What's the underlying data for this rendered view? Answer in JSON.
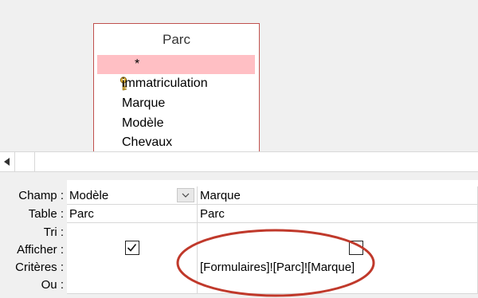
{
  "table": {
    "title": "Parc",
    "fields": [
      "*",
      "immatriculation",
      "Marque",
      "Modèle",
      "Chevaux"
    ]
  },
  "grid": {
    "row_labels": [
      "Champ :",
      "Table :",
      "Tri :",
      "Afficher :",
      "Critères :",
      "Ou :"
    ],
    "columns": [
      {
        "champ": "Modèle",
        "table": "Parc",
        "tri": "",
        "afficher": true,
        "criteres": "",
        "ou": ""
      },
      {
        "champ": "Marque",
        "table": "Parc",
        "tri": "",
        "afficher": false,
        "criteres": "[Formulaires]![Parc]![Marque]",
        "ou": ""
      }
    ]
  },
  "colors": {
    "highlight": "#ffbfc4",
    "border_accent": "#c0504d",
    "annotation": "#c0392b"
  }
}
